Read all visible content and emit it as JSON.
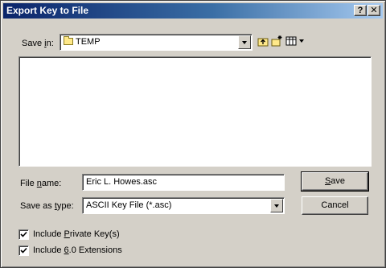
{
  "window": {
    "title": "Export Key to File",
    "help_glyph": "?",
    "close_glyph": "✕"
  },
  "save_in": {
    "label_pre": "Save ",
    "label_key": "i",
    "label_post": "n:",
    "value": "TEMP",
    "icons": [
      "up-one-level-icon",
      "create-new-folder-icon",
      "view-menu-icon"
    ]
  },
  "file_name": {
    "label_pre": "File ",
    "label_key": "n",
    "label_post": "ame:",
    "value": "Eric L. Howes.asc"
  },
  "save_as_type": {
    "label_pre": "Save as ",
    "label_key": "t",
    "label_post": "ype:",
    "value": "ASCII Key File (*.asc)"
  },
  "buttons": {
    "save_key": "S",
    "save_rest": "ave",
    "cancel": "Cancel"
  },
  "options": [
    {
      "pre": "Include ",
      "key": "P",
      "post": "rivate Key(s)",
      "checked": true
    },
    {
      "pre": "Include ",
      "key": "6",
      "post": ".0 Extensions",
      "checked": true
    }
  ]
}
